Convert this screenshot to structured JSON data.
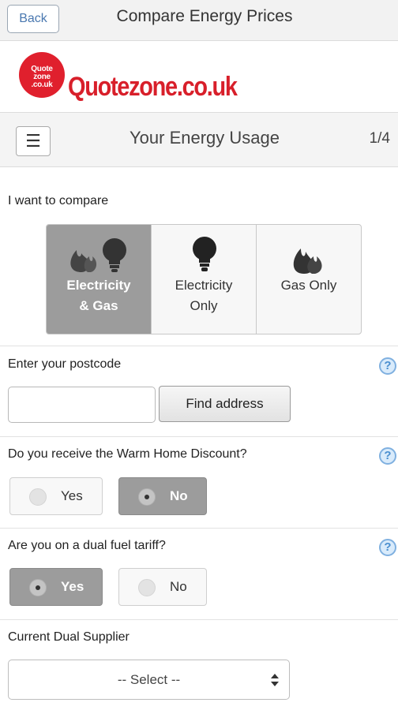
{
  "topbar": {
    "back_label": "Back",
    "title": "Compare Energy Prices"
  },
  "logo": {
    "badge_line1": "Quote",
    "badge_line2": "zone",
    "badge_line3": ".co.uk",
    "text": "Quotezone.co.uk",
    "brand_color": "#d81f2a"
  },
  "step": {
    "title": "Your Energy Usage",
    "counter": "1/4",
    "menu_icon": "hamburger-icon"
  },
  "compare": {
    "label": "I want to compare",
    "options": [
      {
        "line1": "Electricity",
        "line2": "& Gas",
        "selected": true
      },
      {
        "line1": "Electricity",
        "line2": "Only",
        "selected": false
      },
      {
        "line1": "Gas Only",
        "line2": "",
        "selected": false
      }
    ]
  },
  "postcode": {
    "label": "Enter your postcode",
    "value": "",
    "find_label": "Find address",
    "help": "?"
  },
  "warm_home": {
    "label": "Do you receive the Warm Home Discount?",
    "yes": "Yes",
    "no": "No",
    "selected": "No",
    "help": "?"
  },
  "dual_fuel": {
    "label": "Are you on a dual fuel tariff?",
    "yes": "Yes",
    "no": "No",
    "selected": "Yes",
    "help": "?"
  },
  "supplier": {
    "label": "Current Dual Supplier",
    "selected": "-- Select --"
  }
}
